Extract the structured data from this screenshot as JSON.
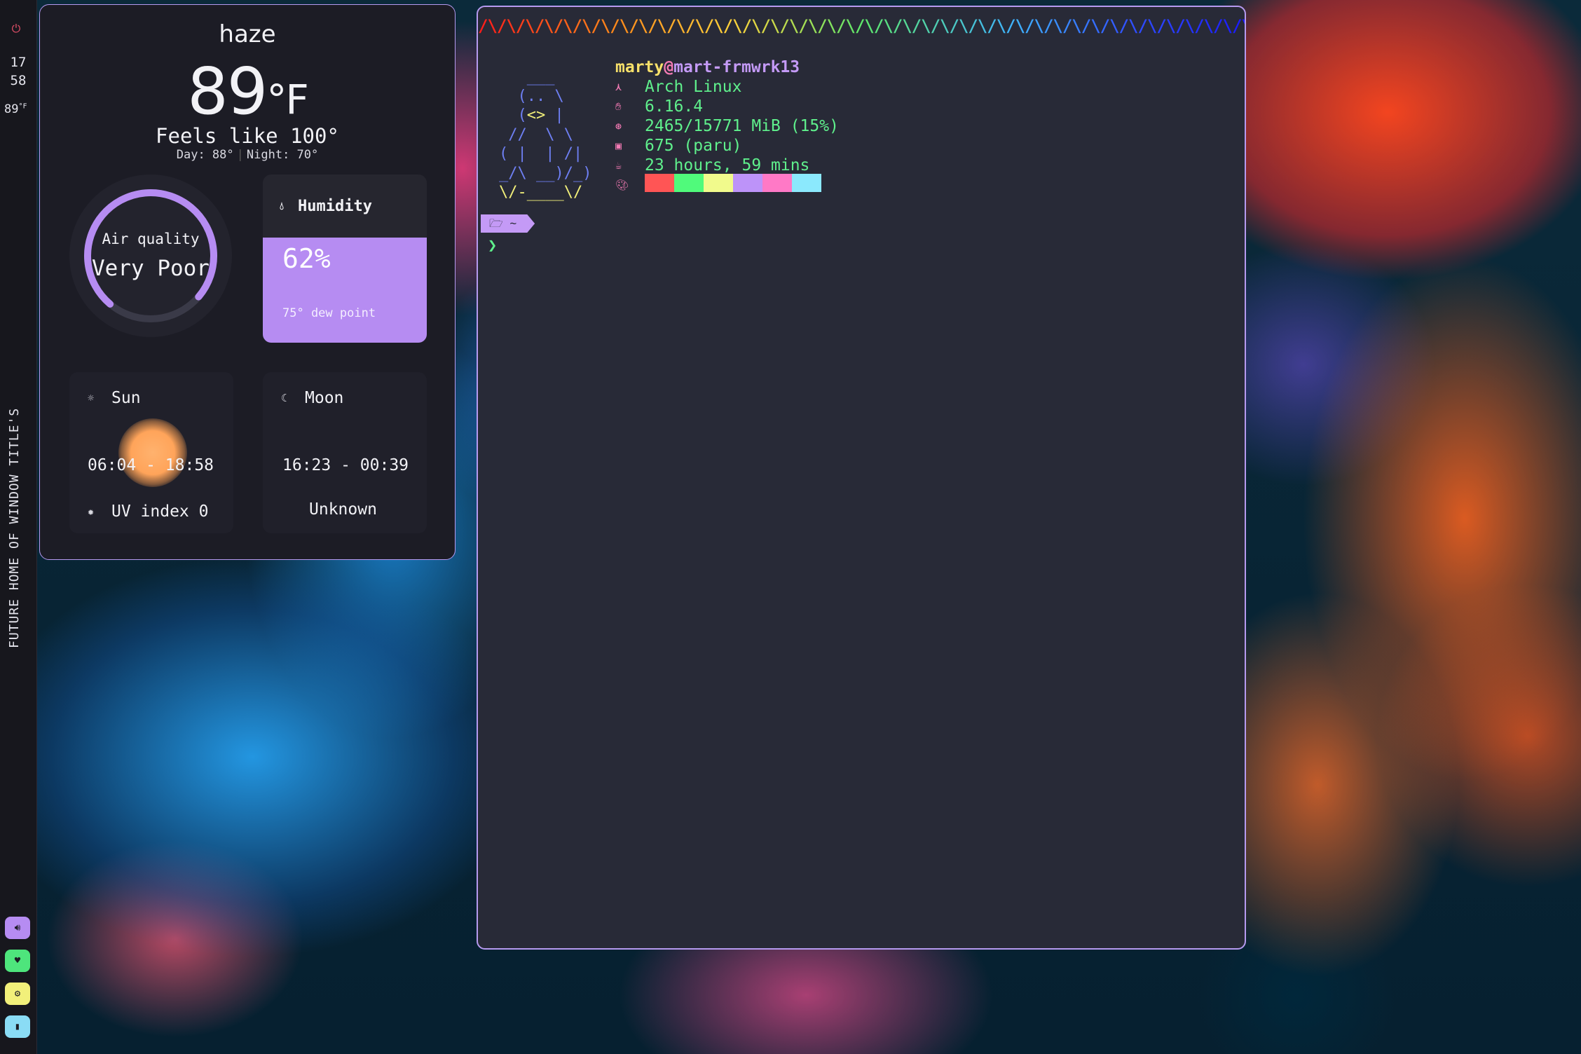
{
  "sidebar": {
    "clock_hour": "17",
    "clock_min": "58",
    "temp": "89",
    "temp_unit": "°F",
    "vertical_title": "FUTURE HOME OF WINDOW TITLE'S",
    "icons": [
      "power-icon",
      "volume-icon",
      "heart-icon",
      "gear-icon",
      "battery-icon"
    ]
  },
  "weather": {
    "condition": "haze",
    "temp": "89",
    "unit": "°F",
    "feels_like": "Feels like 100°",
    "day": "Day: 88°",
    "night": "Night: 70°",
    "air_quality_label": "Air quality",
    "air_quality_value": "Very Poor",
    "humidity_title": "Humidity",
    "humidity_value": "62%",
    "dew_point": "75° dew point",
    "sun_title": "Sun",
    "sun_times": "06:04 - 18:58",
    "uv": "UV index 0",
    "moon_title": "Moon",
    "moon_times": "16:23 - 00:39",
    "moon_phase": "Unknown",
    "colors": {
      "accent": "#b68cf2",
      "card": "#1c1c25"
    }
  },
  "terminal": {
    "rainbow_text": "/\\/\\/\\/\\/\\/\\/\\/\\/\\/\\/\\/\\/\\/\\/\\/\\/\\/\\/\\/\\/\\/\\/\\/\\/\\/\\/\\/\\/\\/\\/\\/\\/\\/\\/\\/\\/\\/\\/\\/\\/\\/\\/\\/\\/\\/\\/\\/\\/\\/\\/\\/\\/",
    "user": "marty",
    "at": "@",
    "host": "mart-frmwrk13",
    "os": "Arch Linux",
    "kernel": "6.16.4",
    "memory": "2465/15771 MiB (15%)",
    "packages": "675 (paru)",
    "uptime": "23 hours, 59 mins",
    "palette": [
      "#ff5555",
      "#50fa7b",
      "#f1fa8c",
      "#bd93f9",
      "#ff79c6",
      "#8be9fd"
    ],
    "prompt_dir": "~",
    "prompt_char": "❯"
  }
}
